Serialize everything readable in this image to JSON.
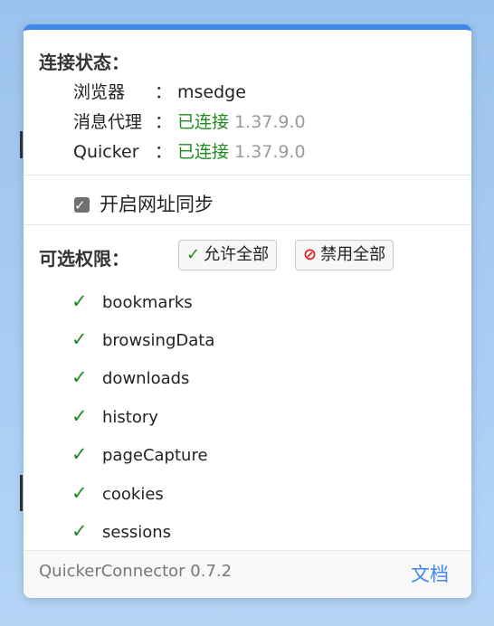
{
  "connection": {
    "title": "连接状态：",
    "browser": {
      "label": "浏览器",
      "colon": "：",
      "value": "msedge"
    },
    "proxy": {
      "label": "消息代理",
      "colon": "：",
      "status": "已连接",
      "version": "1.37.9.0"
    },
    "quicker": {
      "label": "Quicker",
      "colon": "：",
      "status": "已连接",
      "version": "1.37.9.0"
    }
  },
  "sync": {
    "label": "开启网址同步",
    "checked": true
  },
  "permissions": {
    "title": "可选权限：",
    "allow_all": "允许全部",
    "deny_all": "禁用全部",
    "items": [
      "bookmarks",
      "browsingData",
      "downloads",
      "history",
      "pageCapture",
      "cookies",
      "sessions"
    ]
  },
  "footer": {
    "version": "QuickerConnector 0.7.2",
    "docs_link": "文档"
  },
  "colors": {
    "accent": "#3f87e8",
    "connected": "#1f8a1f",
    "deny": "#dd2222"
  },
  "icons": {
    "check": "check-icon",
    "ban": "ban-icon"
  }
}
